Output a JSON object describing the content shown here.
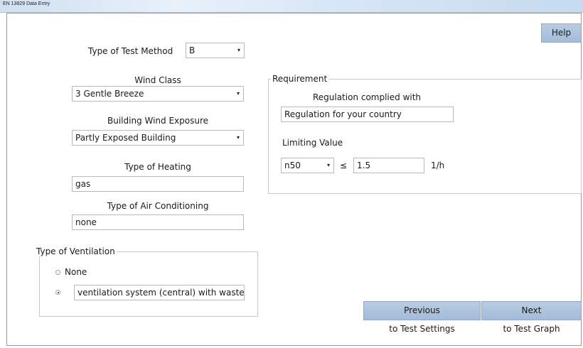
{
  "window": {
    "title": "EN 13829 Data Entry"
  },
  "help_label": "Help",
  "left": {
    "test_method": {
      "label": "Type of Test Method",
      "value": "B"
    },
    "wind_class": {
      "label": "Wind Class",
      "value": "3  Gentle Breeze"
    },
    "wind_exposure": {
      "label": "Building Wind Exposure",
      "value": "Partly Exposed Building"
    },
    "heating": {
      "label": "Type of Heating",
      "value": "gas"
    },
    "air_conditioning": {
      "label": "Type of Air Conditioning",
      "value": "none"
    }
  },
  "ventilation": {
    "legend": "Type of Ventilation",
    "options": [
      {
        "label": "None",
        "selected": false
      },
      {
        "label": "ventilation system (central) with waste",
        "selected": true
      }
    ]
  },
  "requirement": {
    "legend": "Requirement",
    "regulation_label": "Regulation complied with",
    "regulation_value": "Regulation for your country",
    "limiting_label": "Limiting Value",
    "metric_value": "n50",
    "operator": "≤",
    "limit_value": "1.5",
    "unit": "1/h"
  },
  "nav": {
    "previous_label": "Previous",
    "previous_sub": "to Test Settings",
    "next_label": "Next",
    "next_sub": "to Test Graph"
  },
  "icons": {
    "combo_arrow": "chevron-down-icon",
    "radio": "radio-icon"
  }
}
